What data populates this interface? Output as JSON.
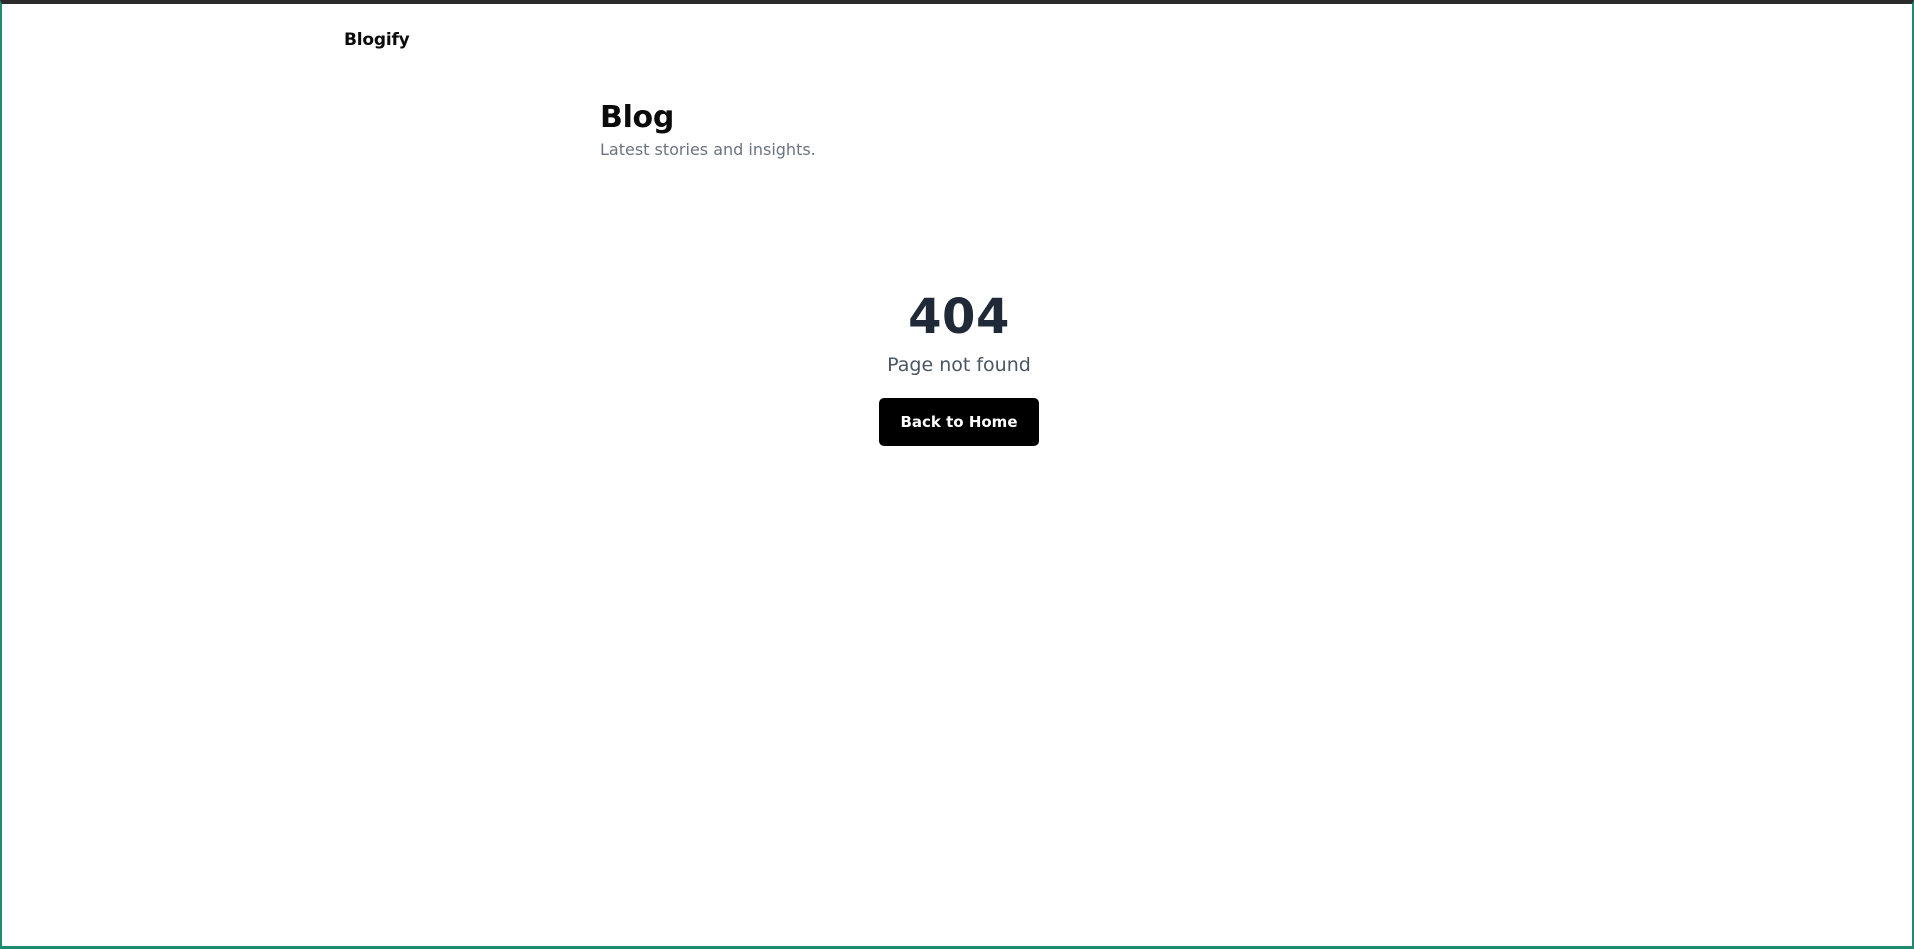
{
  "header": {
    "brand": "Blogify"
  },
  "blog_header": {
    "title": "Blog",
    "subtitle": "Latest stories and insights."
  },
  "not_found": {
    "code": "404",
    "message": "Page not found",
    "button_label": "Back to Home"
  },
  "colors": {
    "button_background": "#000000",
    "button_text": "#ffffff",
    "code_text": "#1f2937",
    "subtitle_text": "#6b7280",
    "window_border": "#1f8a70"
  }
}
